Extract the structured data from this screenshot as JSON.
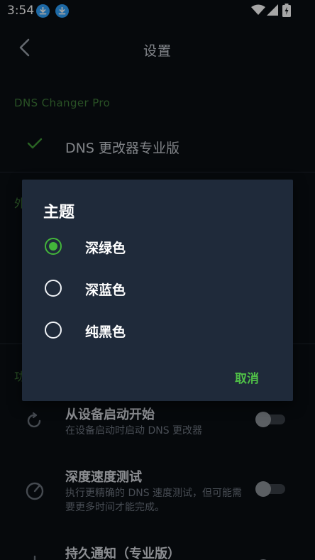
{
  "status_bar": {
    "time": "3:54"
  },
  "app_bar": {
    "title": "设置"
  },
  "sections": {
    "pro_header": "DNS Changer Pro",
    "pro_item_label": "DNS 更改器专业版",
    "appearance_header_partial": "外",
    "functions_header_partial": "功"
  },
  "settings": [
    {
      "title": "从设备启动开始",
      "subtitle": "在设备启动时启动 DNS 更改器",
      "enabled": false,
      "icon": "boot-restart-icon"
    },
    {
      "title": "深度速度测试",
      "subtitle": "执行更精确的 DNS 速度测试，但可能需要更多时间才能完成。",
      "enabled": false,
      "icon": "speedometer-icon"
    },
    {
      "title": "持久通知（专业版）",
      "subtitle": "",
      "enabled": false,
      "icon": "notification-icon"
    }
  ],
  "dialog": {
    "title": "主题",
    "options": [
      {
        "label": "深绿色",
        "selected": true
      },
      {
        "label": "深蓝色",
        "selected": false
      },
      {
        "label": "纯黑色",
        "selected": false
      }
    ],
    "cancel_label": "取消"
  },
  "colors": {
    "accent": "#43b53a",
    "background": "#0a0e13",
    "dialog_bg": "#1f2a3a",
    "section_header": "#3f7d3a",
    "download_badge": "#2fa3ff"
  }
}
